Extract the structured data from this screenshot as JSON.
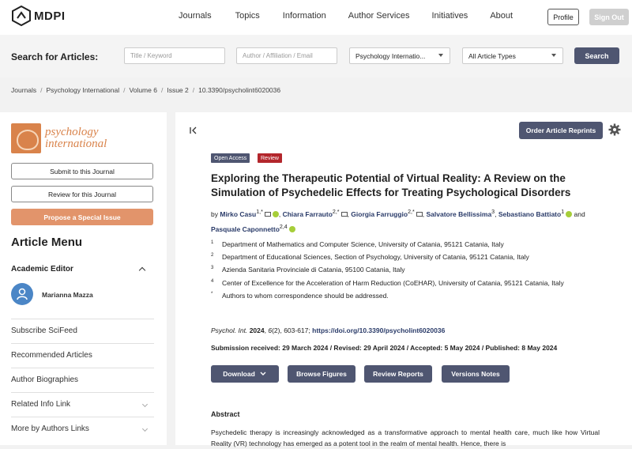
{
  "topnav": {
    "logo": "MDPI",
    "items": [
      "Journals",
      "Topics",
      "Information",
      "Author Services",
      "Initiatives",
      "About"
    ],
    "profile": "Profile",
    "signout": "Sign Out"
  },
  "search": {
    "label": "Search for Articles:",
    "title_placeholder": "Title / Keyword",
    "author_placeholder": "Author / Affiliation / Email",
    "journal_value": "Psychology Internatio...",
    "type_value": "All Article Types",
    "button": "Search"
  },
  "breadcrumb": [
    "Journals",
    "Psychology International",
    "Volume 6",
    "Issue 2",
    "10.3390/psycholint6020036"
  ],
  "sidebar": {
    "journal_name_1": "psychology",
    "journal_name_2": "international",
    "submit": "Submit to this Journal",
    "review": "Review for this Journal",
    "propose": "Propose a Special Issue",
    "menu_title": "Article Menu",
    "academic_editor": "Academic Editor",
    "editor_name": "Marianna Mazza",
    "items": [
      "Subscribe SciFeed",
      "Recommended Articles",
      "Author Biographies",
      "Related Info Link",
      "More by Authors Links"
    ]
  },
  "article": {
    "reprints": "Order Article Reprints",
    "badge_open": "Open Access",
    "badge_review": "Review",
    "title": "Exploring the Therapeutic Potential of Virtual Reality: A Review on the Simulation of Psychedelic Effects for Treating Psychological Disorders",
    "by": "by",
    "authors": [
      {
        "name": "Mirko Casu",
        "sup": "1,*"
      },
      {
        "name": "Chiara Farrauto",
        "sup": "2,*"
      },
      {
        "name": "Giorgia Farruggio",
        "sup": "2,*"
      },
      {
        "name": "Salvatore Bellissima",
        "sup": "3"
      },
      {
        "name": "Sebastiano Battiato",
        "sup": "1"
      },
      {
        "name": "Pasquale Caponnetto",
        "sup": "2,4"
      }
    ],
    "and": "and",
    "affiliations": [
      {
        "num": "1",
        "text": "Department of Mathematics and Computer Science, University of Catania, 95121 Catania, Italy"
      },
      {
        "num": "2",
        "text": "Department of Educational Sciences, Section of Psychology, University of Catania, 95121 Catania, Italy"
      },
      {
        "num": "3",
        "text": "Azienda Sanitaria Provinciale di Catania, 95100 Catania, Italy"
      },
      {
        "num": "4",
        "text": "Center of Excellence for the Acceleration of Harm Reduction (CoEHAR), University of Catania, 95121 Catania, Italy"
      },
      {
        "num": "*",
        "text": "Authors to whom correspondence should be addressed."
      }
    ],
    "cite_journal": "Psychol. Int.",
    "cite_year": "2024",
    "cite_vol": "6",
    "cite_rest": "(2), 603-617;",
    "doi": "https://doi.org/10.3390/psycholint6020036",
    "dates": "Submission received: 29 March 2024 / Revised: 29 April 2024 / Accepted: 5 May 2024 / Published: 8 May 2024",
    "buttons": {
      "download": "Download",
      "figures": "Browse Figures",
      "reports": "Review Reports",
      "versions": "Versions Notes"
    },
    "abstract_heading": "Abstract",
    "abstract_text": "Psychedelic therapy is increasingly acknowledged as a transformative approach to mental health care, much like how Virtual Reality (VR) technology has emerged as a potent tool in the realm of mental health. Hence, there is"
  },
  "colors": {
    "accent": "#4f5671",
    "journal": "#d9834b",
    "orcid": "#a6ce39",
    "review_badge": "#b3262c"
  }
}
